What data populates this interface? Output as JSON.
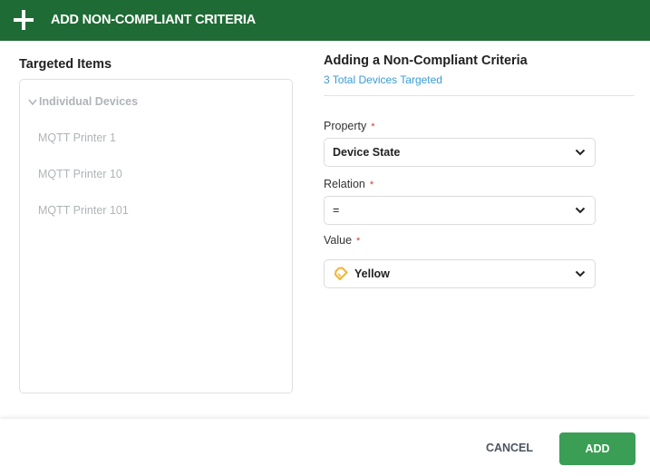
{
  "header": {
    "icon": "plus-icon",
    "title": "ADD NON-COMPLIANT CRITERIA"
  },
  "targeted": {
    "title": "Targeted Items",
    "group": {
      "icon": "chevron-down-icon",
      "label": "Individual Devices",
      "items": [
        "MQTT Printer 1",
        "MQTT Printer 10",
        "MQTT Printer 101"
      ]
    }
  },
  "form": {
    "title": "Adding a Non-Compliant Criteria",
    "subtitle": "3 Total Devices Targeted",
    "required_marker": "*",
    "property": {
      "label": "Property",
      "value": "Device State"
    },
    "relation": {
      "label": "Relation",
      "value": "="
    },
    "value": {
      "label": "Value",
      "value": "Yellow",
      "icon": "tag-icon",
      "icon_color": "#f2b431"
    }
  },
  "footer": {
    "cancel_label": "CANCEL",
    "add_label": "ADD"
  },
  "colors": {
    "header_bg": "#1f6b35",
    "accent_link": "#3a9bd4",
    "add_button": "#3a9e55",
    "required": "#d63b3b"
  }
}
